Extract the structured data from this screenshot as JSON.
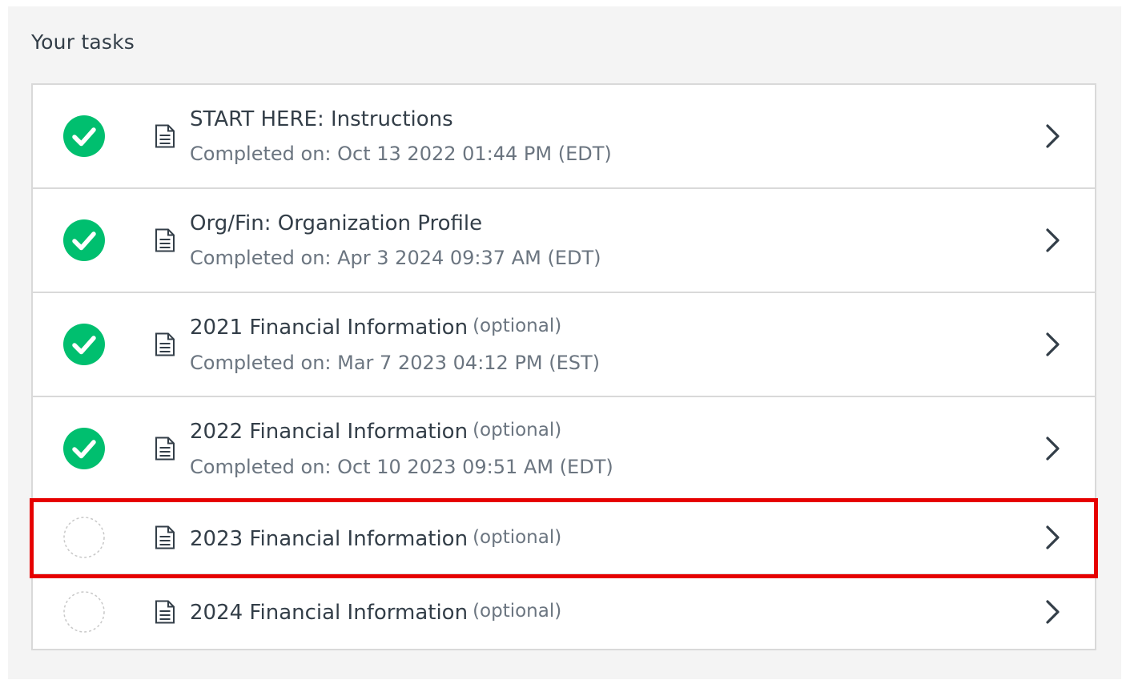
{
  "panel": {
    "title": "Your tasks"
  },
  "colors": {
    "complete_green": "#00bf6f",
    "highlight_red": "#e60000"
  },
  "tasks": [
    {
      "title": "START HERE: Instructions",
      "optional": "",
      "completed": "Completed on: Oct 13 2022 01:44 PM (EDT)",
      "status": "complete"
    },
    {
      "title": "Org/Fin: Organization Profile",
      "optional": "",
      "completed": "Completed on: Apr 3 2024 09:37 AM (EDT)",
      "status": "complete"
    },
    {
      "title": "2021 Financial Information",
      "optional": "(optional)",
      "completed": "Completed on: Mar 7 2023 04:12 PM (EST)",
      "status": "complete"
    },
    {
      "title": "2022 Financial Information",
      "optional": "(optional)",
      "completed": "Completed on: Oct 10 2023 09:51 AM (EDT)",
      "status": "complete"
    },
    {
      "title": "2023 Financial Information",
      "optional": "(optional)",
      "completed": "",
      "status": "incomplete",
      "highlighted": true
    },
    {
      "title": "2024 Financial Information",
      "optional": "(optional)",
      "completed": "",
      "status": "incomplete"
    }
  ]
}
